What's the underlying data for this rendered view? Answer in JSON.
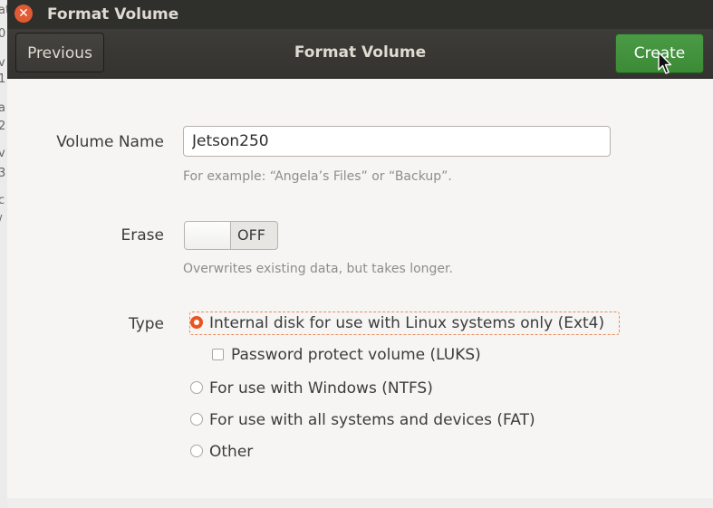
{
  "window": {
    "title": "Format Volume"
  },
  "header": {
    "previous_label": "Previous",
    "title": "Format Volume",
    "create_label": "Create"
  },
  "form": {
    "volume_name_label": "Volume Name",
    "volume_name_value": "Jetson250",
    "volume_name_hint": "For example: “Angela’s Files” or “Backup”.",
    "erase_label": "Erase",
    "erase_state": "OFF",
    "erase_hint": "Overwrites existing data, but takes longer.",
    "type_label": "Type",
    "type_options": [
      {
        "label": "Internal disk for use with Linux systems only (Ext4)",
        "selected": true
      },
      {
        "label": "For use with Windows (NTFS)",
        "selected": false
      },
      {
        "label": "For use with all systems and devices (FAT)",
        "selected": false
      },
      {
        "label": "Other",
        "selected": false
      }
    ],
    "password_protect_label": "Password protect volume (LUKS)",
    "password_protect_checked": false
  },
  "colors": {
    "accent": "#e95420",
    "create_button": "#3b8a36",
    "titlebar": "#2f2f2c",
    "close_button": "#e25a33"
  }
}
